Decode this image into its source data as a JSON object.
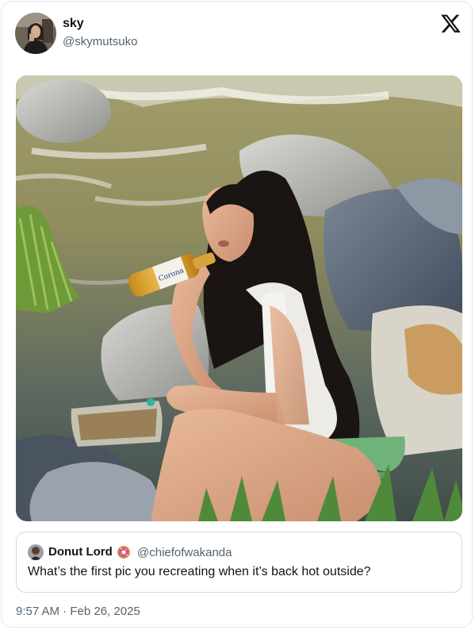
{
  "author": {
    "name": "sky",
    "handle": "@skymutsuko",
    "avatar_icon": "profile-photo"
  },
  "brand_icon": "x-logo-icon",
  "photo": {
    "bottle_label": "Corona"
  },
  "quoted_post": {
    "name": "Donut Lord",
    "emoji_icon": "donut-icon",
    "handle": "@chiefofwakanda",
    "text": "What’s the first pic you recreating when it’s back hot outside?"
  },
  "timestamp": "9:57 AM · Feb 26, 2025",
  "colors": {
    "text_primary": "#0f1419",
    "text_secondary": "#536471",
    "border": "#cfd9de"
  }
}
